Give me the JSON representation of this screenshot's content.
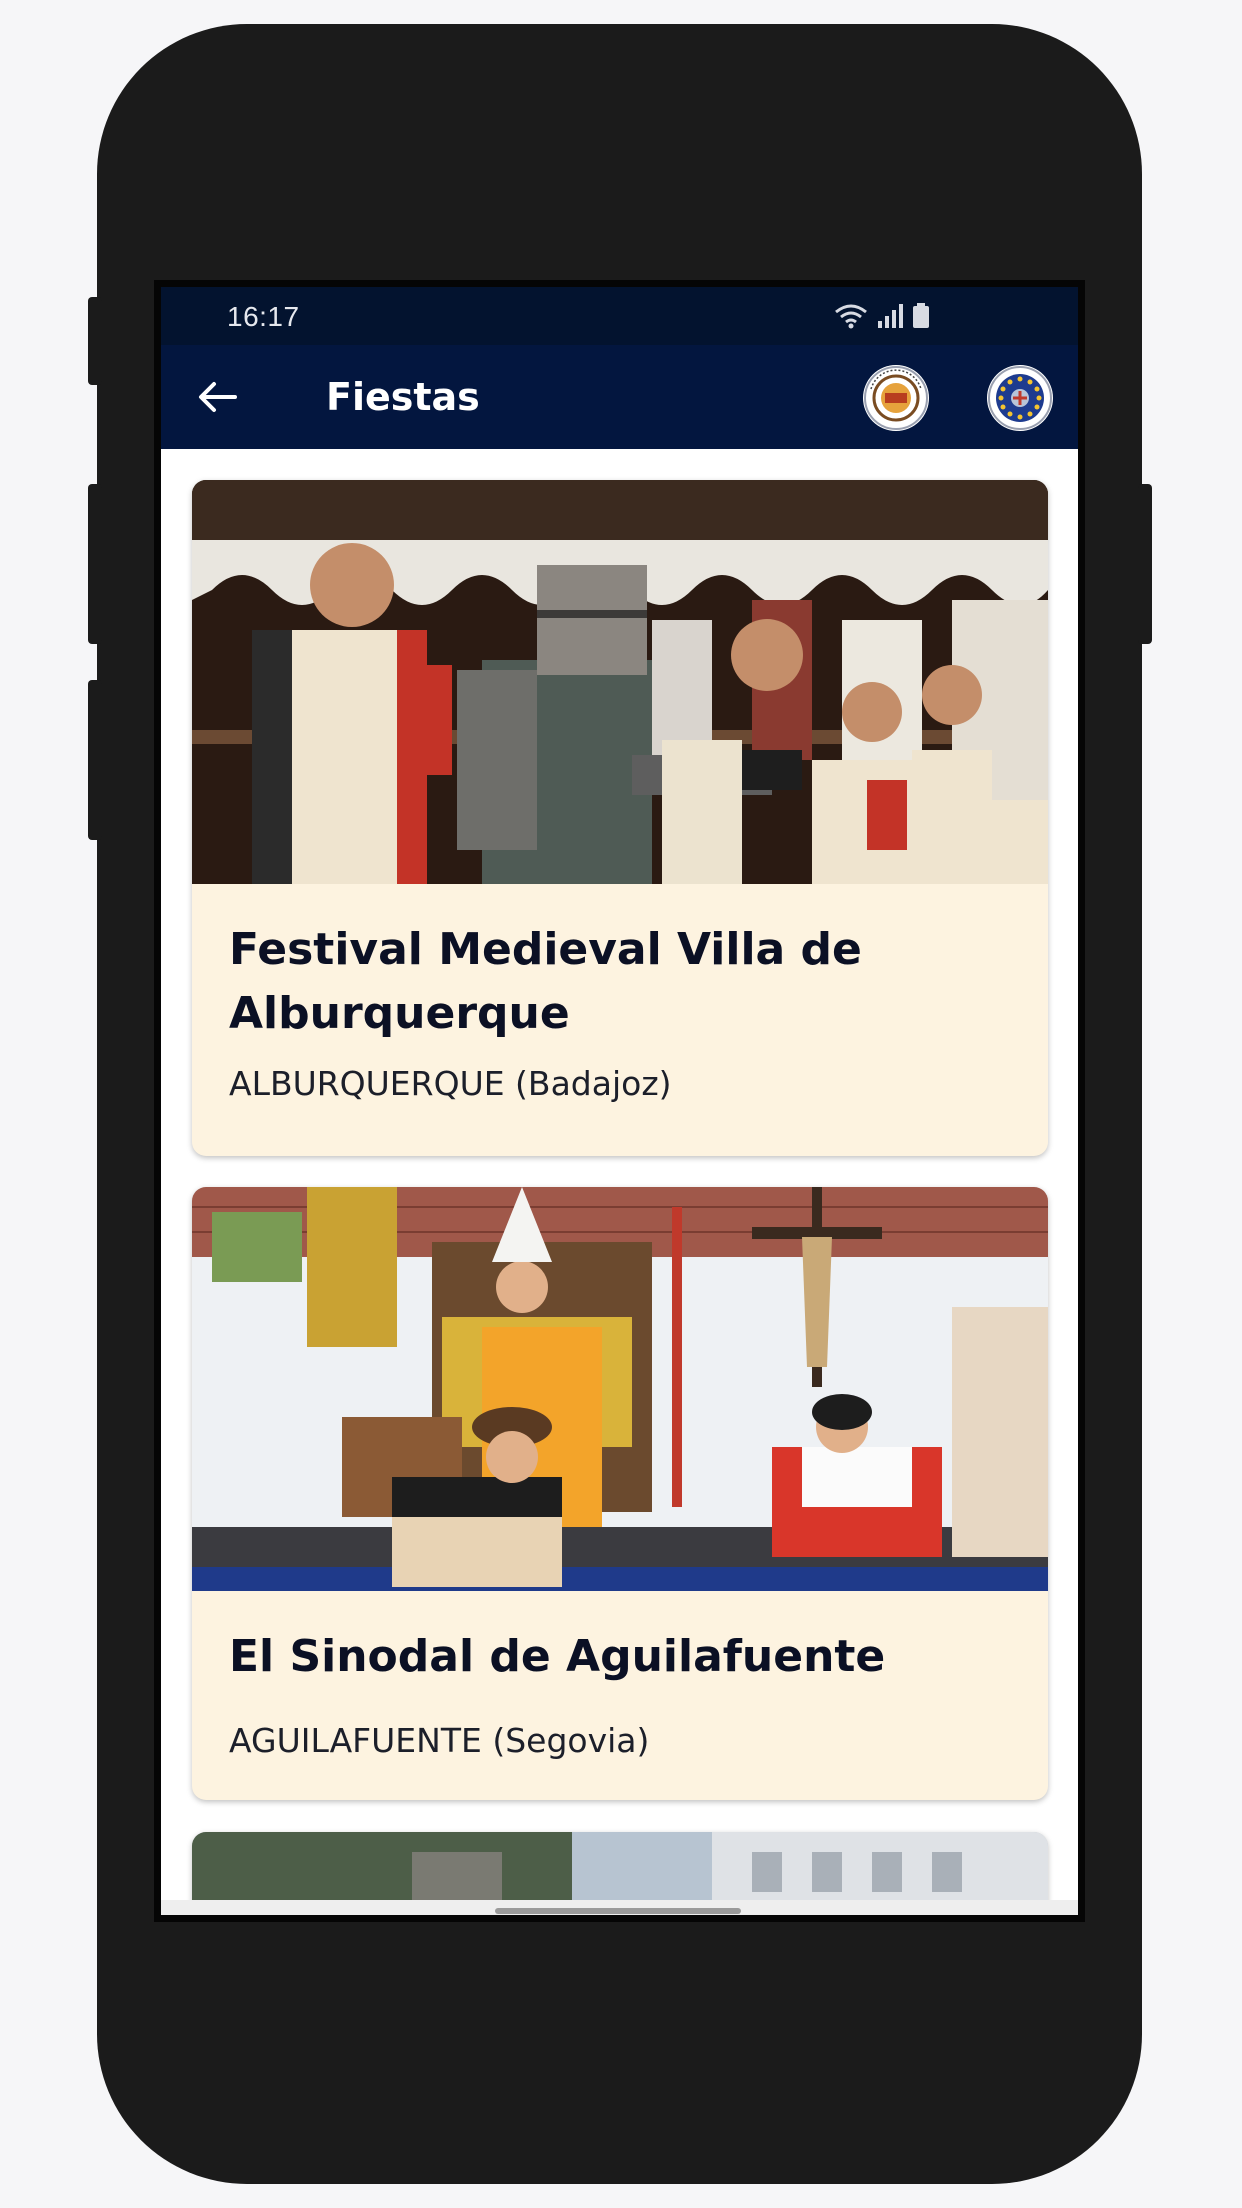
{
  "status_bar": {
    "time": "16:17"
  },
  "app_bar": {
    "title": "Fiestas",
    "logos": [
      "association-logo",
      "european-union-logo"
    ]
  },
  "events": [
    {
      "title": "Festival Medieval Villa de Alburquerque",
      "location": "ALBURQUERQUE (Badajoz)"
    },
    {
      "title": "El Sinodal de Aguilafuente",
      "location": "AGUILAFUENTE (Segovia)"
    }
  ],
  "colors": {
    "status_bar": "#03132f",
    "app_bar": "#03163f",
    "card_background": "#fdf3e0",
    "title_text": "#0b1024"
  }
}
